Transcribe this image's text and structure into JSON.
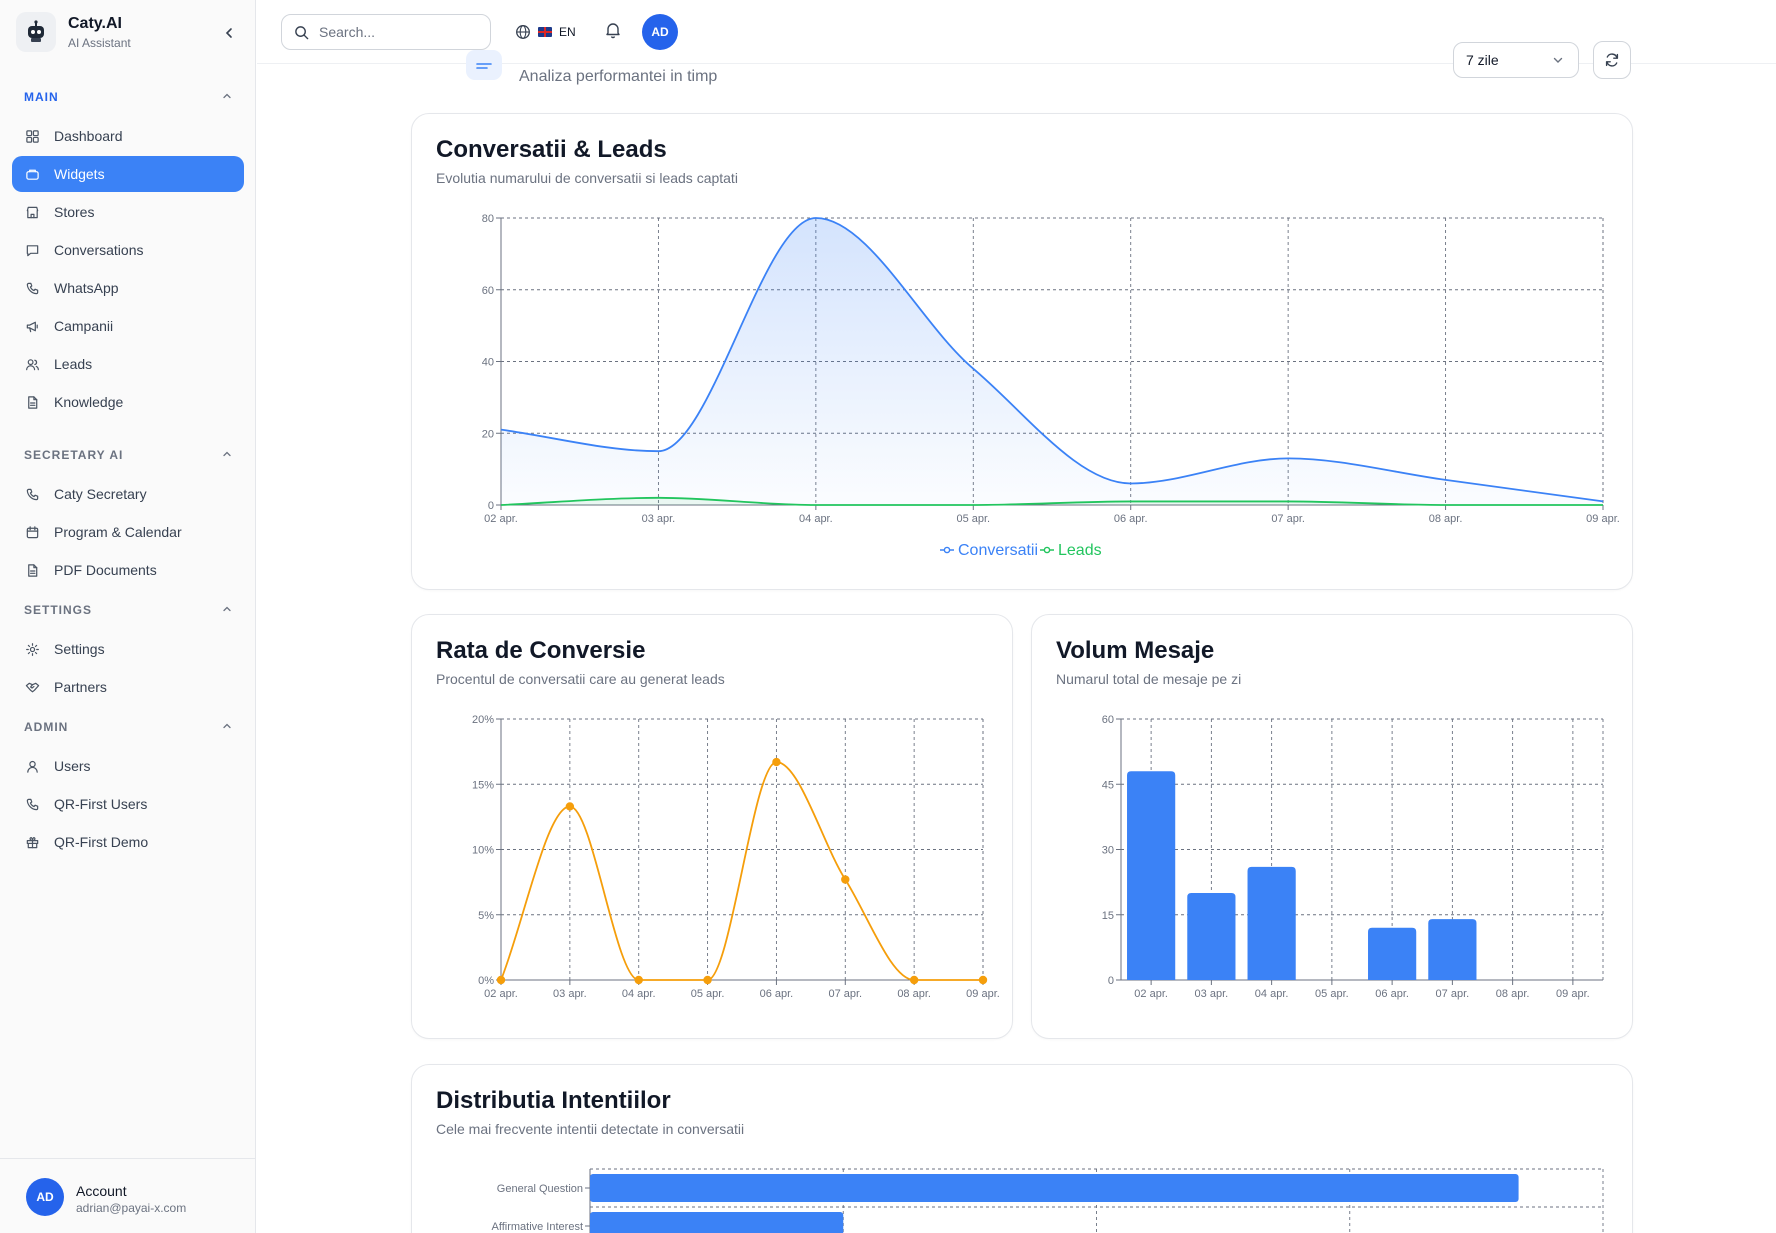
{
  "sidebar": {
    "brand_name": "Caty.AI",
    "brand_sub": "AI Assistant",
    "sections": [
      {
        "title": "MAIN",
        "items": [
          {
            "label": "Dashboard",
            "icon": "dashboard-icon"
          },
          {
            "label": "Widgets",
            "icon": "widget-icon",
            "active": true
          },
          {
            "label": "Stores",
            "icon": "store-icon"
          },
          {
            "label": "Conversations",
            "icon": "chat-icon"
          },
          {
            "label": "WhatsApp",
            "icon": "phone-icon"
          },
          {
            "label": "Campanii",
            "icon": "megaphone-icon"
          },
          {
            "label": "Leads",
            "icon": "users-icon"
          },
          {
            "label": "Knowledge",
            "icon": "document-icon"
          }
        ]
      },
      {
        "title": "SECRETARY AI",
        "items": [
          {
            "label": "Caty Secretary",
            "icon": "phone-icon"
          },
          {
            "label": "Program & Calendar",
            "icon": "calendar-icon"
          },
          {
            "label": "PDF Documents",
            "icon": "document-icon"
          }
        ]
      },
      {
        "title": "SETTINGS",
        "items": [
          {
            "label": "Settings",
            "icon": "gear-icon"
          },
          {
            "label": "Partners",
            "icon": "handshake-icon"
          }
        ]
      },
      {
        "title": "ADMIN",
        "items": [
          {
            "label": "Users",
            "icon": "user-icon"
          },
          {
            "label": "QR-First Users",
            "icon": "phone-icon"
          },
          {
            "label": "QR-First Demo",
            "icon": "gift-icon"
          }
        ]
      }
    ],
    "account": {
      "initials": "AD",
      "name": "Account",
      "email": "adrian@payai-x.com"
    }
  },
  "topbar": {
    "search_placeholder": "Search...",
    "language": "EN",
    "avatar_initials": "AD"
  },
  "page": {
    "subtitle": "Analiza performantei in timp",
    "period": "7 zile"
  },
  "colors": {
    "accent": "#3b82f6",
    "leads": "#22c55e",
    "rate": "#f59e0b"
  },
  "cards": {
    "conversations": {
      "title": "Conversatii & Leads",
      "subtitle": "Evolutia numarului de conversatii si leads captati"
    },
    "rate": {
      "title": "Rata de Conversie",
      "subtitle": "Procentul de conversatii care au generat leads"
    },
    "volume": {
      "title": "Volum Mesaje",
      "subtitle": "Numarul total de mesaje pe zi"
    },
    "intents": {
      "title": "Distributia Intentiilor",
      "subtitle": "Cele mai frecvente intentii detectate in conversatii"
    }
  },
  "chart_data": [
    {
      "type": "area",
      "categories": [
        "02 apr.",
        "03 apr.",
        "04 apr.",
        "05 apr.",
        "06 apr.",
        "07 apr.",
        "08 apr.",
        "09 apr."
      ],
      "series": [
        {
          "name": "Conversatii",
          "values": [
            21,
            15,
            80,
            38,
            6,
            13,
            7,
            1
          ]
        },
        {
          "name": "Leads",
          "values": [
            0,
            2,
            0,
            0,
            1,
            1,
            0,
            0
          ]
        }
      ],
      "ylim": [
        0,
        80
      ],
      "yticks": [
        "0",
        "20",
        "40",
        "60",
        "80"
      ],
      "grid": true,
      "legend": "bottom-center"
    },
    {
      "type": "line",
      "categories": [
        "02 apr.",
        "03 apr.",
        "04 apr.",
        "05 apr.",
        "06 apr.",
        "07 apr.",
        "08 apr.",
        "09 apr."
      ],
      "values": [
        0,
        13.3,
        0,
        0,
        16.7,
        7.7,
        0,
        0
      ],
      "ylim": [
        0,
        20
      ],
      "yticks": [
        "0%",
        "5%",
        "10%",
        "15%",
        "20%"
      ],
      "grid": true
    },
    {
      "type": "bar",
      "categories": [
        "02 apr.",
        "03 apr.",
        "04 apr.",
        "05 apr.",
        "06 apr.",
        "07 apr.",
        "08 apr.",
        "09 apr."
      ],
      "values": [
        48,
        20,
        26,
        0,
        12,
        14,
        0,
        0
      ],
      "ylim": [
        0,
        60
      ],
      "yticks": [
        "0",
        "15",
        "30",
        "45",
        "60"
      ],
      "grid": true
    },
    {
      "type": "bar",
      "orientation": "horizontal",
      "categories": [
        "General Question",
        "Affirmative Interest"
      ],
      "values": [
        11,
        3
      ],
      "xlim": [
        0,
        12
      ],
      "grid": true
    }
  ]
}
